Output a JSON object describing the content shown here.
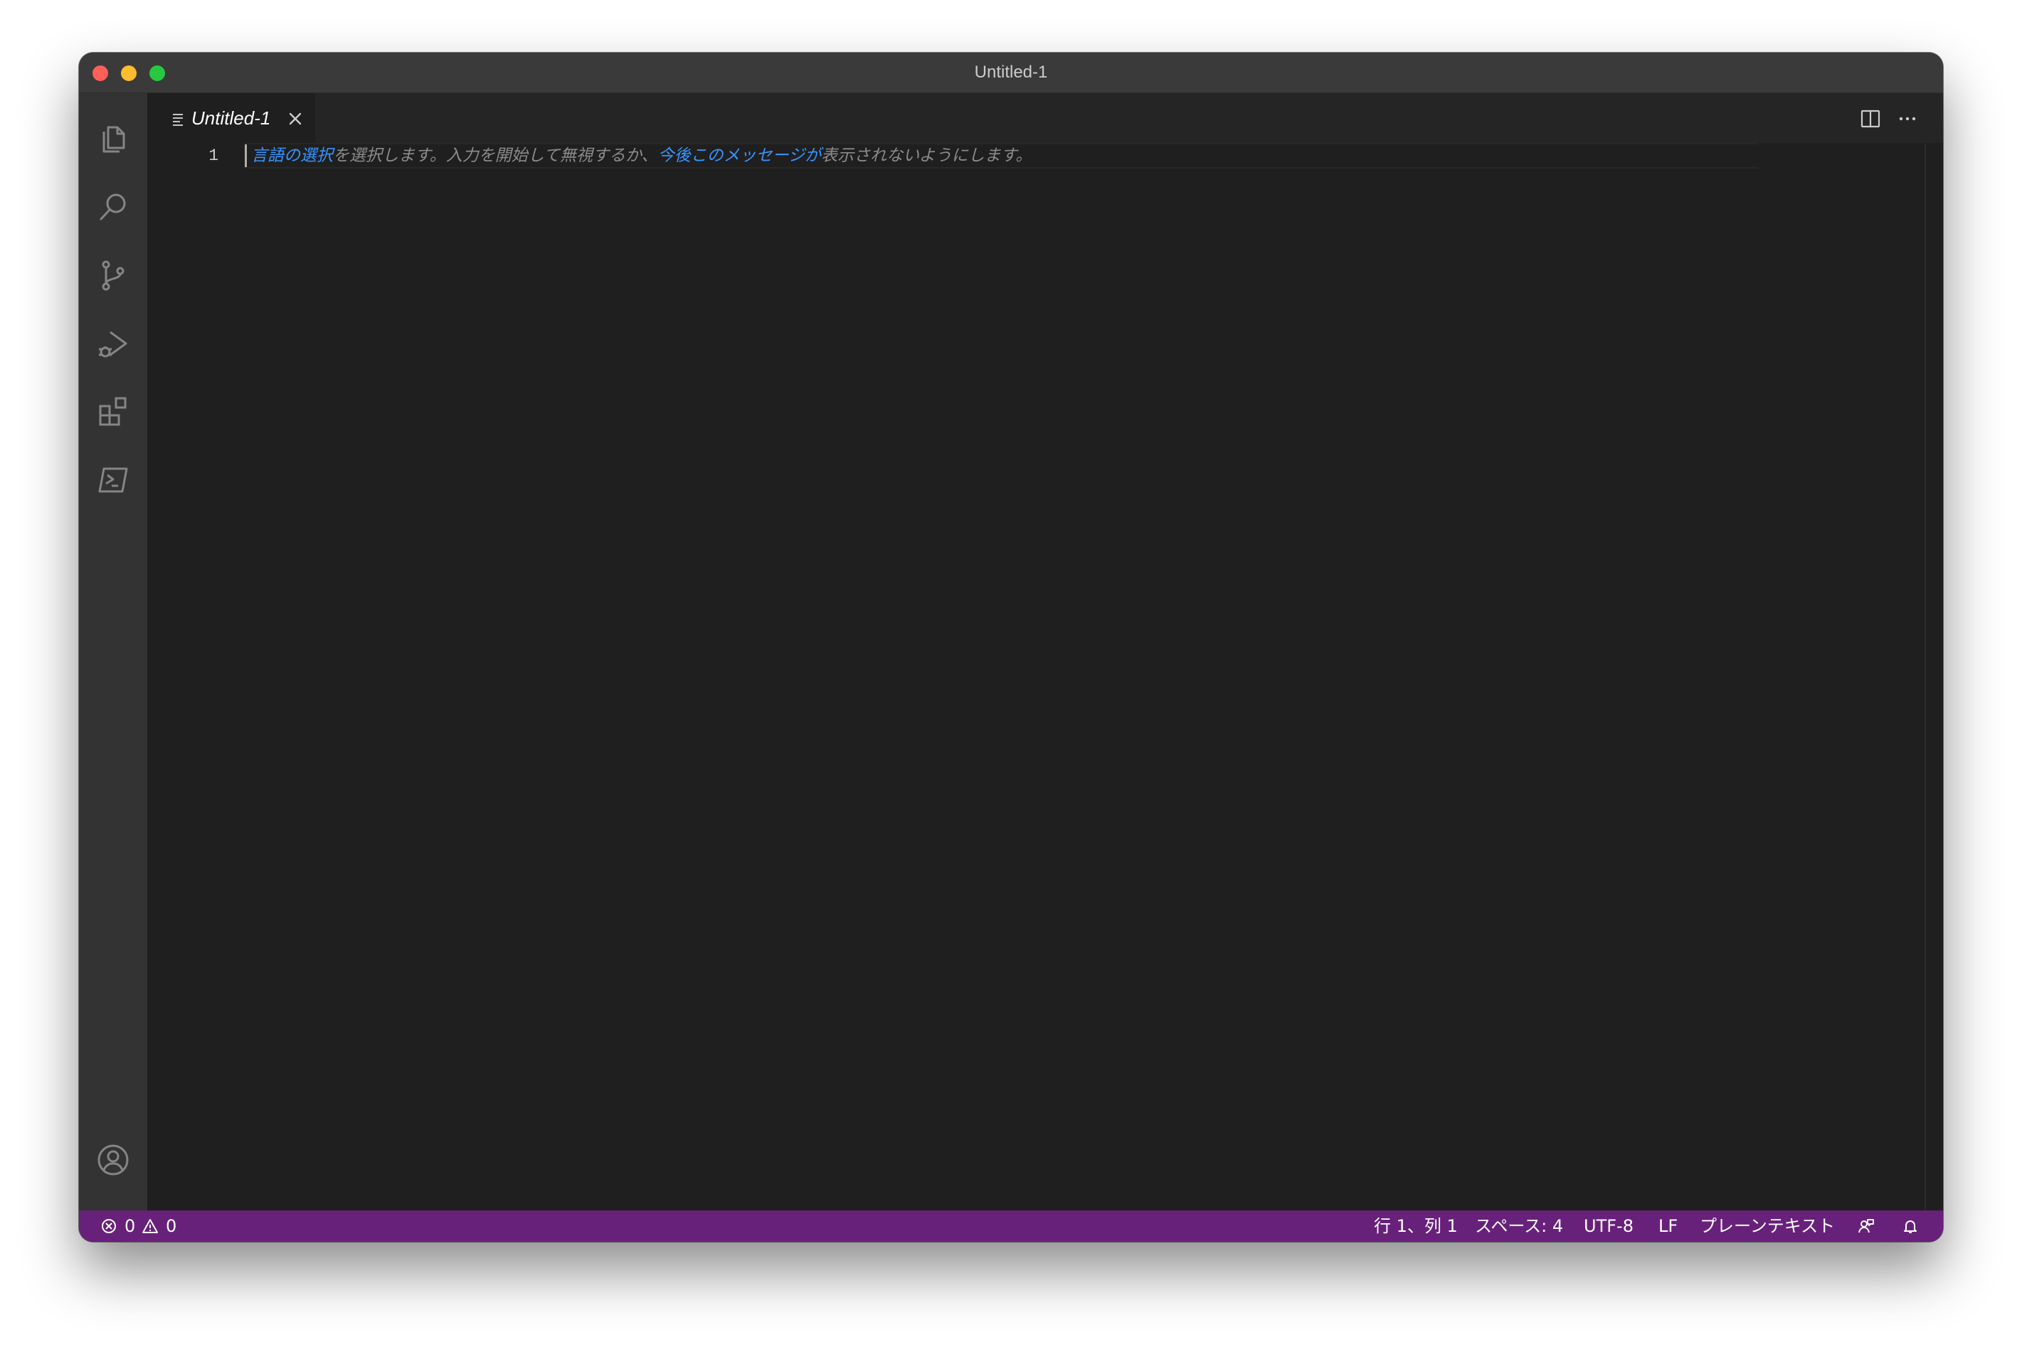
{
  "window": {
    "title": "Untitled-1"
  },
  "activity_bar": {
    "items": [
      {
        "icon": "files-icon",
        "label": "Explorer"
      },
      {
        "icon": "search-icon",
        "label": "Search"
      },
      {
        "icon": "source-control-icon",
        "label": "Source Control"
      },
      {
        "icon": "run-debug-icon",
        "label": "Run and Debug"
      },
      {
        "icon": "extensions-icon",
        "label": "Extensions"
      },
      {
        "icon": "terminal-icon",
        "label": "Terminal"
      }
    ],
    "bottom_items": [
      {
        "icon": "account-icon"
      },
      {
        "icon": "gear-icon"
      }
    ]
  },
  "tabs": [
    {
      "label": "Untitled-1",
      "active": true,
      "icon": "file-lines-icon"
    }
  ],
  "editor": {
    "line_number": "1",
    "hint": {
      "link1": "言語の選択",
      "text1": "を選択します。入力を開始して無視するか、",
      "link2": "今後このメッセージが",
      "text2": "表示されないようにします。"
    }
  },
  "status_bar": {
    "errors": "0",
    "warnings": "0",
    "position": "行 1、列 1",
    "indent": "スペース: 4",
    "encoding": "UTF-8",
    "eol": "LF",
    "language": "プレーンテキスト"
  },
  "colors": {
    "status_bar_bg": "#68217a",
    "link": "#3794ff",
    "editor_bg": "#1f1f1f",
    "activity_bar_bg": "#333333"
  }
}
